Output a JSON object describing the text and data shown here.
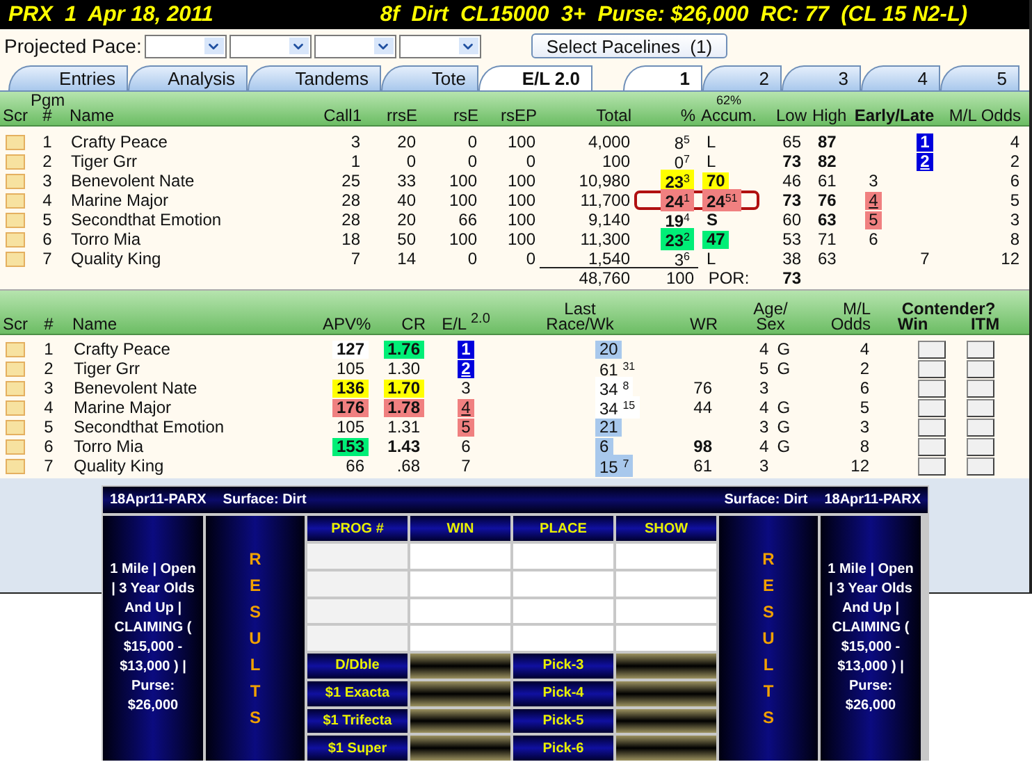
{
  "header": {
    "race": "PRX  1  Apr 18, 2011",
    "info": "8f  Dirt  CL15000  3+  Purse: $26,000  RC: 77  (CL 15 N2-L)"
  },
  "pace": {
    "label": "Projected Pace:",
    "dropdowns": [
      {
        "kind": "select"
      },
      {
        "kind": "select"
      },
      {
        "kind": "select"
      },
      {
        "kind": "select"
      }
    ],
    "button": "Select Pacelines  (1)"
  },
  "view_tabs": [
    {
      "label": "Entries",
      "selected": false
    },
    {
      "label": "Analysis",
      "selected": false
    },
    {
      "label": "Tandems",
      "selected": false
    },
    {
      "label": "Tote",
      "selected": false
    },
    {
      "label": "E/L 2.0",
      "selected": true
    }
  ],
  "race_tabs": [
    {
      "label": "1",
      "selected": true
    },
    {
      "label": "2",
      "selected": false
    },
    {
      "label": "3",
      "selected": false
    },
    {
      "label": "4",
      "selected": false
    },
    {
      "label": "5",
      "selected": false
    }
  ],
  "pace_table": {
    "columns": [
      {
        "label": "Scr"
      },
      {
        "label": "Pgm #"
      },
      {
        "label": "Name"
      },
      {
        "label": "Call1"
      },
      {
        "label": "rrsE"
      },
      {
        "label": "rsE"
      },
      {
        "label": "rsEP"
      },
      {
        "label": "Total"
      },
      {
        "label": "%"
      },
      {
        "label": "Accum.",
        "note": "62%"
      },
      {
        "label": "Low"
      },
      {
        "label": "High"
      },
      {
        "label": "Early/Late"
      },
      {
        "label": "M/L Odds"
      }
    ],
    "rows": [
      {
        "scratched": false,
        "pgm": "1",
        "name": "Crafty Peace",
        "call1": "3",
        "rrse": "20",
        "rse": "0",
        "rsep": "100",
        "total": "4,000",
        "pct": {
          "text": "8$^{5}$",
          "bold": false
        },
        "accum": {
          "text": "L",
          "bold": false
        },
        "low": {
          "text": "65",
          "bold": false
        },
        "high": {
          "text": "87",
          "bold": true
        },
        "late": {
          "text": "1",
          "color": "#0000dd",
          "underlined": false
        },
        "odds": "4",
        "outlined": false
      },
      {
        "scratched": false,
        "pgm": "2",
        "name": "Tiger Grr",
        "call1": "1",
        "rrse": "0",
        "rse": "0",
        "rsep": "0",
        "total": "100",
        "pct": {
          "text": "0$^{7}$",
          "bold": false
        },
        "accum": {
          "text": "L",
          "bold": false
        },
        "low": {
          "text": "73",
          "bold": true
        },
        "high": {
          "text": "82",
          "bold": true
        },
        "late": {
          "text": "2",
          "color": "#0000dd",
          "underlined": true
        },
        "odds": "2",
        "outlined": false
      },
      {
        "scratched": false,
        "pgm": "3",
        "name": "Benevolent Nate",
        "call1": "25",
        "rrse": "33",
        "rse": "100",
        "rsep": "100",
        "total": "10,980",
        "pct": {
          "text": "23$^{3}$",
          "bold": true,
          "color": "#ffff00"
        },
        "accum": {
          "text": "70",
          "bold": true,
          "color": "#ffff00"
        },
        "low": {
          "text": "46",
          "bold": false
        },
        "high": {
          "text": "61",
          "bold": false
        },
        "early": {
          "text": "3",
          "underlined": false
        },
        "odds": "6",
        "outlined": false
      },
      {
        "scratched": false,
        "pgm": "4",
        "name": "Marine Major",
        "call1": "28",
        "rrse": "40",
        "rse": "100",
        "rsep": "100",
        "total": "11,700",
        "pct": {
          "text": "24$^{1}$",
          "bold": true,
          "color": "#f08080"
        },
        "accum": {
          "text": "24$^{51}$",
          "bold": true,
          "color": "#f08080"
        },
        "low": {
          "text": "73",
          "bold": true
        },
        "high": {
          "text": "76",
          "bold": true
        },
        "early": {
          "text": "4",
          "color": "#f08080",
          "underlined": true
        },
        "odds": "5",
        "outlined": true
      },
      {
        "scratched": false,
        "pgm": "5",
        "name": "Secondthat Emotion",
        "call1": "28",
        "rrse": "20",
        "rse": "66",
        "rsep": "100",
        "total": "9,140",
        "pct": {
          "text": "19$^{4}$",
          "bold": true
        },
        "accum": {
          "text": "S",
          "bold": true
        },
        "low": {
          "text": "60",
          "bold": false
        },
        "high": {
          "text": "63",
          "bold": true
        },
        "early": {
          "text": "5",
          "color": "#f08080",
          "underlined": false
        },
        "odds": "3",
        "outlined": false
      },
      {
        "scratched": false,
        "pgm": "6",
        "name": "Torro Mia",
        "call1": "18",
        "rrse": "50",
        "rse": "100",
        "rsep": "100",
        "total": "11,300",
        "pct": {
          "text": "23$^{2}$",
          "bold": true,
          "color": "#00ee77"
        },
        "accum": {
          "text": "47",
          "bold": true,
          "color": "#00ee77"
        },
        "low": {
          "text": "53",
          "bold": false
        },
        "high": {
          "text": "71",
          "bold": false
        },
        "early": {
          "text": "6",
          "underlined": false
        },
        "odds": "8",
        "outlined": false
      },
      {
        "scratched": false,
        "pgm": "7",
        "name": "Quality King",
        "call1": "7",
        "rrse": "14",
        "rse": "0",
        "rsep": "0",
        "total": "1,540",
        "pct": {
          "text": "3$^{6}$",
          "bold": false
        },
        "accum": {
          "text": "L",
          "bold": false
        },
        "low": {
          "text": "38",
          "bold": false
        },
        "high": {
          "text": "63",
          "bold": false
        },
        "late": {
          "text": "7",
          "underlined": false
        },
        "odds": "12",
        "outlined": false
      }
    ],
    "totals": {
      "total": "48,760",
      "pct": "100",
      "label": "POR:",
      "value": "73"
    }
  },
  "rating_table": {
    "columns": [
      {
        "label": "Scr"
      },
      {
        "label": "#"
      },
      {
        "label": "Name"
      },
      {
        "label": "APV%"
      },
      {
        "label": "CR"
      },
      {
        "label": "E/L $^{2.0}$"
      },
      {
        "label": "Last Race/Wk"
      },
      {
        "label": "WR"
      },
      {
        "label": "Age/ Sex"
      },
      {
        "label": "M/L Odds"
      },
      {
        "label": "Contender?",
        "sub": [
          "Win",
          "ITM"
        ]
      }
    ],
    "rows": [
      {
        "scratched": false,
        "pgm": "1",
        "name": "Crafty Peace",
        "apv": {
          "text": "127",
          "bold": true,
          "color": "#ffffff"
        },
        "cr": {
          "text": "1.76",
          "bold": true,
          "color": "#00ee77"
        },
        "el": {
          "text": "1",
          "color": "#0000dd",
          "underlined": false
        },
        "last": {
          "text": "20",
          "color": "#a8c8ec"
        },
        "age": "4",
        "sex": "G",
        "odds": "4",
        "win": false,
        "itm": false
      },
      {
        "scratched": false,
        "pgm": "2",
        "name": "Tiger Grr",
        "apv": {
          "text": "105",
          "bold": false
        },
        "cr": {
          "text": "1.30",
          "bold": false
        },
        "el": {
          "text": "2",
          "color": "#0000dd",
          "underlined": true
        },
        "last": {
          "text": "61 $^{31}$"
        },
        "age": "5",
        "sex": "G",
        "odds": "2",
        "win": false,
        "itm": false
      },
      {
        "scratched": false,
        "pgm": "3",
        "name": "Benevolent Nate",
        "apv": {
          "text": "136",
          "bold": true,
          "color": "#ffff00"
        },
        "cr": {
          "text": "1.70",
          "bold": true,
          "color": "#ffff00"
        },
        "el": {
          "text": "3",
          "underlined": false
        },
        "last": {
          "text": "34 $^{8}$",
          "color": "#ffffff"
        },
        "wr": {
          "text": "76",
          "bold": false
        },
        "age": "3",
        "odds": "6",
        "win": false,
        "itm": false
      },
      {
        "scratched": false,
        "pgm": "4",
        "name": "Marine Major",
        "apv": {
          "text": "176",
          "bold": true,
          "color": "#f08080"
        },
        "cr": {
          "text": "1.78",
          "bold": true,
          "color": "#f08080"
        },
        "el": {
          "text": "4",
          "color": "#f08080",
          "underlined": true
        },
        "last": {
          "text": "34 $^{15}$",
          "color": "#ffffff"
        },
        "wr": {
          "text": "44",
          "bold": false
        },
        "age": "4",
        "sex": "G",
        "odds": "5",
        "win": false,
        "itm": false
      },
      {
        "scratched": false,
        "pgm": "5",
        "name": "Secondthat Emotion",
        "apv": {
          "text": "105",
          "bold": false
        },
        "cr": {
          "text": "1.31",
          "bold": false
        },
        "el": {
          "text": "5",
          "color": "#f08080",
          "underlined": false
        },
        "last": {
          "text": "21",
          "color": "#a8c8ec"
        },
        "age": "3",
        "sex": "G",
        "odds": "3",
        "win": false,
        "itm": false
      },
      {
        "scratched": false,
        "pgm": "6",
        "name": "Torro Mia",
        "apv": {
          "text": "153",
          "bold": true,
          "color": "#00ee77"
        },
        "cr": {
          "text": "1.43",
          "bold": true
        },
        "el": {
          "text": "6",
          "underlined": false
        },
        "last": {
          "text": "6",
          "color": "#a8c8ec"
        },
        "wr": {
          "text": "98",
          "bold": true
        },
        "age": "4",
        "sex": "G",
        "odds": "8",
        "win": false,
        "itm": false
      },
      {
        "scratched": false,
        "pgm": "7",
        "name": "Quality King",
        "apv": {
          "text": "66",
          "bold": false
        },
        "cr": {
          "text": ".68",
          "bold": false
        },
        "el": {
          "text": "7",
          "underlined": false
        },
        "last": {
          "text": "15 $^{7}$",
          "color": "#a8c8ec"
        },
        "wr": {
          "text": "61",
          "bold": false
        },
        "age": "3",
        "odds": "12",
        "win": false,
        "itm": false
      }
    ]
  },
  "results": {
    "header_left": [
      "18Apr11-PARX",
      "Surface: Dirt"
    ],
    "header_right": [
      "Surface: Dirt",
      "18Apr11-PARX"
    ],
    "race_info_left": "1 Mile | Open | 3 Year Olds And Up | CLAIMING ( $15,000 - $13,000 ) | Purse: $26,000",
    "results_label_left": "RESULTS",
    "results_label_right": "RESULTS",
    "race_info_right": "1 Mile | Open | 3 Year Olds And Up | CLAIMING ( $15,000 - $13,000 ) | Purse: $26,000",
    "columns": [
      "PROG #",
      "WIN",
      "PLACE",
      "SHOW"
    ],
    "entry_rows": [
      {
        "kind": "blank"
      },
      {
        "kind": "blank"
      },
      {
        "kind": "blank"
      },
      {
        "kind": "blank"
      }
    ],
    "wagers": [
      {
        "left": "D/Dble",
        "right": "Pick-3"
      },
      {
        "left": "$1 Exacta",
        "right": "Pick-4"
      },
      {
        "left": "$1 Trifecta",
        "right": "Pick-5"
      },
      {
        "left": "$1 Super",
        "right": "Pick-6"
      }
    ]
  }
}
